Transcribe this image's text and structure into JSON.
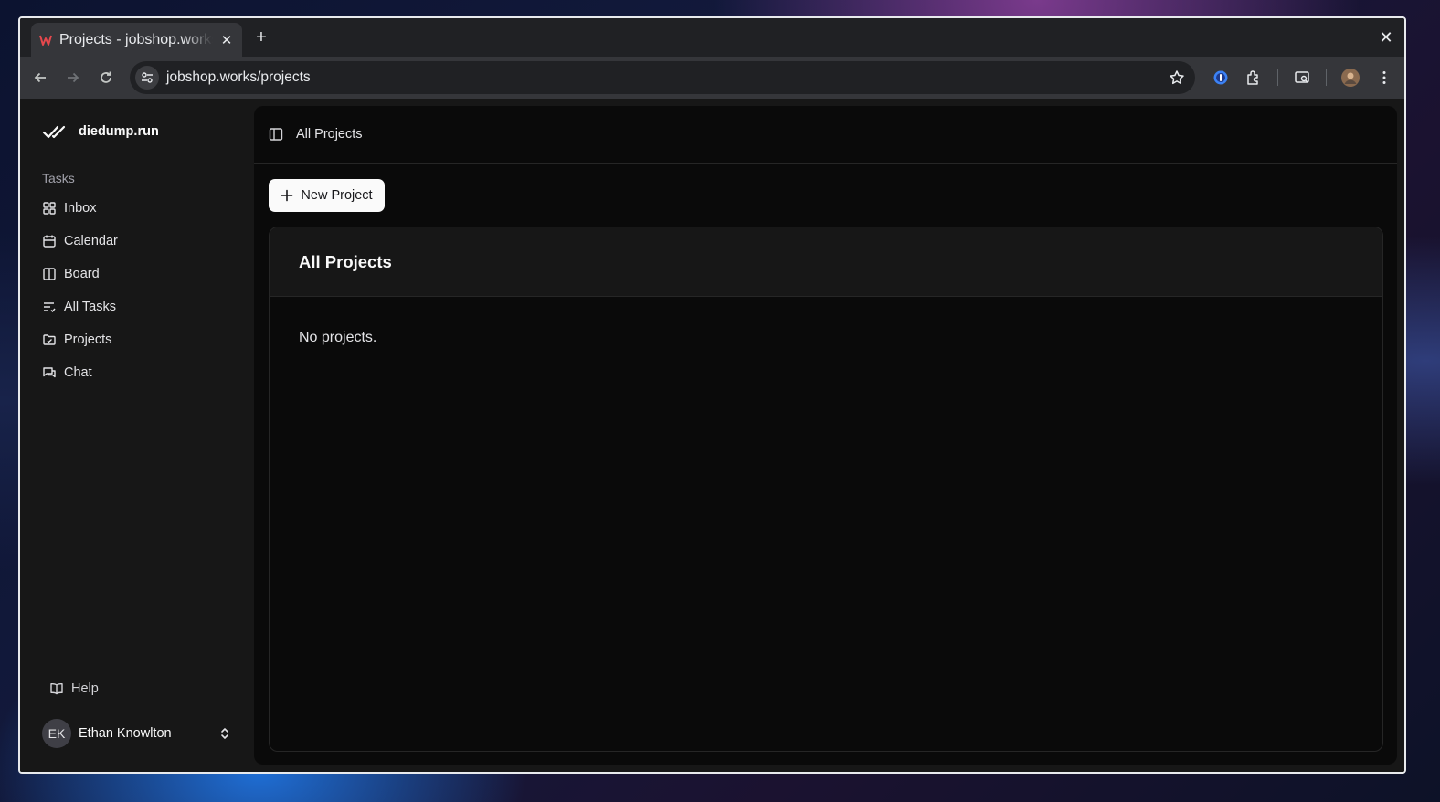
{
  "browser": {
    "tab_title": "Projects - jobshop.works",
    "url": "jobshop.works/projects"
  },
  "sidebar": {
    "brand": "diedump.run",
    "section_label": "Tasks",
    "items": [
      {
        "label": "Inbox",
        "icon": "grid-icon"
      },
      {
        "label": "Calendar",
        "icon": "calendar-icon"
      },
      {
        "label": "Board",
        "icon": "columns-icon"
      },
      {
        "label": "All Tasks",
        "icon": "list-check-icon"
      },
      {
        "label": "Projects",
        "icon": "folder-icon"
      },
      {
        "label": "Chat",
        "icon": "chat-icon"
      }
    ],
    "help_label": "Help",
    "user": {
      "initials": "EK",
      "name": "Ethan Knowlton"
    }
  },
  "main": {
    "breadcrumb": "All Projects",
    "new_project_label": "New Project",
    "card_title": "All Projects",
    "empty_text": "No projects."
  },
  "colors": {
    "app_background": "#171717",
    "main_background": "#0a0a0a",
    "primary_button": "#fafafa",
    "favicon": "#e5484d"
  }
}
